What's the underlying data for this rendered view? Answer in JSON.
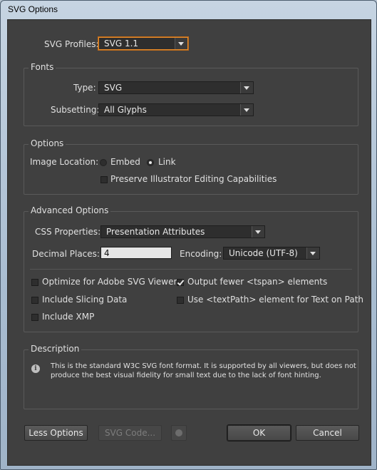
{
  "window": {
    "title": "SVG Options"
  },
  "profiles": {
    "label": "SVG Profiles:",
    "value": "SVG 1.1"
  },
  "fonts": {
    "group_label": "Fonts",
    "type_label": "Type:",
    "type_value": "SVG",
    "subsetting_label": "Subsetting:",
    "subsetting_value": "All Glyphs"
  },
  "options": {
    "group_label": "Options",
    "image_location_label": "Image Location:",
    "embed_label": "Embed",
    "embed_selected": false,
    "link_label": "Link",
    "link_selected": true,
    "preserve_label": "Preserve Illustrator Editing Capabilities",
    "preserve_checked": false
  },
  "advanced": {
    "group_label": "Advanced Options",
    "css_label": "CSS Properties:",
    "css_value": "Presentation Attributes",
    "decimal_label": "Decimal Places:",
    "decimal_value": "4",
    "encoding_label": "Encoding:",
    "encoding_value": "Unicode (UTF-8)",
    "checkboxes": [
      {
        "label": "Optimize for Adobe SVG Viewer",
        "checked": false
      },
      {
        "label": "Output fewer <tspan> elements",
        "checked": true
      },
      {
        "label": "Include Slicing Data",
        "checked": false
      },
      {
        "label": "Use <textPath> element for Text on Path",
        "checked": false
      },
      {
        "label": "Include XMP",
        "checked": false
      }
    ]
  },
  "description": {
    "group_label": "Description",
    "line1": "This is the standard W3C SVG font format.  It is supported by all viewers, but does not",
    "line2": "produce the best visual fidelity for small text due to the lack of font hinting."
  },
  "buttons": {
    "less_options": "Less Options",
    "svg_code": "SVG Code...",
    "ok": "OK",
    "cancel": "Cancel"
  }
}
